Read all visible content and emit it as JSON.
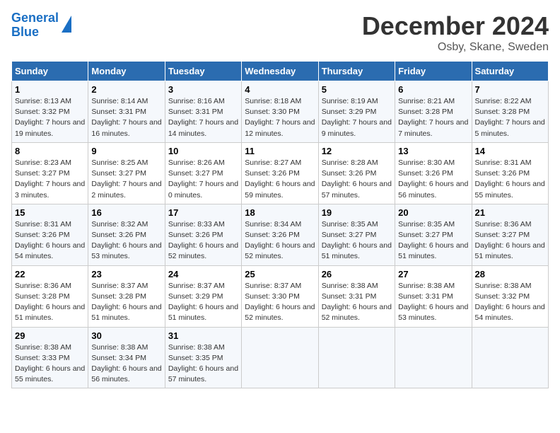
{
  "logo": {
    "line1": "General",
    "line2": "Blue"
  },
  "title": "December 2024",
  "subtitle": "Osby, Skane, Sweden",
  "days_of_week": [
    "Sunday",
    "Monday",
    "Tuesday",
    "Wednesday",
    "Thursday",
    "Friday",
    "Saturday"
  ],
  "weeks": [
    [
      {
        "day": "1",
        "sunrise": "8:13 AM",
        "sunset": "3:32 PM",
        "daylight": "7 hours and 19 minutes."
      },
      {
        "day": "2",
        "sunrise": "8:14 AM",
        "sunset": "3:31 PM",
        "daylight": "7 hours and 16 minutes."
      },
      {
        "day": "3",
        "sunrise": "8:16 AM",
        "sunset": "3:31 PM",
        "daylight": "7 hours and 14 minutes."
      },
      {
        "day": "4",
        "sunrise": "8:18 AM",
        "sunset": "3:30 PM",
        "daylight": "7 hours and 12 minutes."
      },
      {
        "day": "5",
        "sunrise": "8:19 AM",
        "sunset": "3:29 PM",
        "daylight": "7 hours and 9 minutes."
      },
      {
        "day": "6",
        "sunrise": "8:21 AM",
        "sunset": "3:28 PM",
        "daylight": "7 hours and 7 minutes."
      },
      {
        "day": "7",
        "sunrise": "8:22 AM",
        "sunset": "3:28 PM",
        "daylight": "7 hours and 5 minutes."
      }
    ],
    [
      {
        "day": "8",
        "sunrise": "8:23 AM",
        "sunset": "3:27 PM",
        "daylight": "7 hours and 3 minutes."
      },
      {
        "day": "9",
        "sunrise": "8:25 AM",
        "sunset": "3:27 PM",
        "daylight": "7 hours and 2 minutes."
      },
      {
        "day": "10",
        "sunrise": "8:26 AM",
        "sunset": "3:27 PM",
        "daylight": "7 hours and 0 minutes."
      },
      {
        "day": "11",
        "sunrise": "8:27 AM",
        "sunset": "3:26 PM",
        "daylight": "6 hours and 59 minutes."
      },
      {
        "day": "12",
        "sunrise": "8:28 AM",
        "sunset": "3:26 PM",
        "daylight": "6 hours and 57 minutes."
      },
      {
        "day": "13",
        "sunrise": "8:30 AM",
        "sunset": "3:26 PM",
        "daylight": "6 hours and 56 minutes."
      },
      {
        "day": "14",
        "sunrise": "8:31 AM",
        "sunset": "3:26 PM",
        "daylight": "6 hours and 55 minutes."
      }
    ],
    [
      {
        "day": "15",
        "sunrise": "8:31 AM",
        "sunset": "3:26 PM",
        "daylight": "6 hours and 54 minutes."
      },
      {
        "day": "16",
        "sunrise": "8:32 AM",
        "sunset": "3:26 PM",
        "daylight": "6 hours and 53 minutes."
      },
      {
        "day": "17",
        "sunrise": "8:33 AM",
        "sunset": "3:26 PM",
        "daylight": "6 hours and 52 minutes."
      },
      {
        "day": "18",
        "sunrise": "8:34 AM",
        "sunset": "3:26 PM",
        "daylight": "6 hours and 52 minutes."
      },
      {
        "day": "19",
        "sunrise": "8:35 AM",
        "sunset": "3:27 PM",
        "daylight": "6 hours and 51 minutes."
      },
      {
        "day": "20",
        "sunrise": "8:35 AM",
        "sunset": "3:27 PM",
        "daylight": "6 hours and 51 minutes."
      },
      {
        "day": "21",
        "sunrise": "8:36 AM",
        "sunset": "3:27 PM",
        "daylight": "6 hours and 51 minutes."
      }
    ],
    [
      {
        "day": "22",
        "sunrise": "8:36 AM",
        "sunset": "3:28 PM",
        "daylight": "6 hours and 51 minutes."
      },
      {
        "day": "23",
        "sunrise": "8:37 AM",
        "sunset": "3:28 PM",
        "daylight": "6 hours and 51 minutes."
      },
      {
        "day": "24",
        "sunrise": "8:37 AM",
        "sunset": "3:29 PM",
        "daylight": "6 hours and 51 minutes."
      },
      {
        "day": "25",
        "sunrise": "8:37 AM",
        "sunset": "3:30 PM",
        "daylight": "6 hours and 52 minutes."
      },
      {
        "day": "26",
        "sunrise": "8:38 AM",
        "sunset": "3:31 PM",
        "daylight": "6 hours and 52 minutes."
      },
      {
        "day": "27",
        "sunrise": "8:38 AM",
        "sunset": "3:31 PM",
        "daylight": "6 hours and 53 minutes."
      },
      {
        "day": "28",
        "sunrise": "8:38 AM",
        "sunset": "3:32 PM",
        "daylight": "6 hours and 54 minutes."
      }
    ],
    [
      {
        "day": "29",
        "sunrise": "8:38 AM",
        "sunset": "3:33 PM",
        "daylight": "6 hours and 55 minutes."
      },
      {
        "day": "30",
        "sunrise": "8:38 AM",
        "sunset": "3:34 PM",
        "daylight": "6 hours and 56 minutes."
      },
      {
        "day": "31",
        "sunrise": "8:38 AM",
        "sunset": "3:35 PM",
        "daylight": "6 hours and 57 minutes."
      },
      null,
      null,
      null,
      null
    ]
  ]
}
